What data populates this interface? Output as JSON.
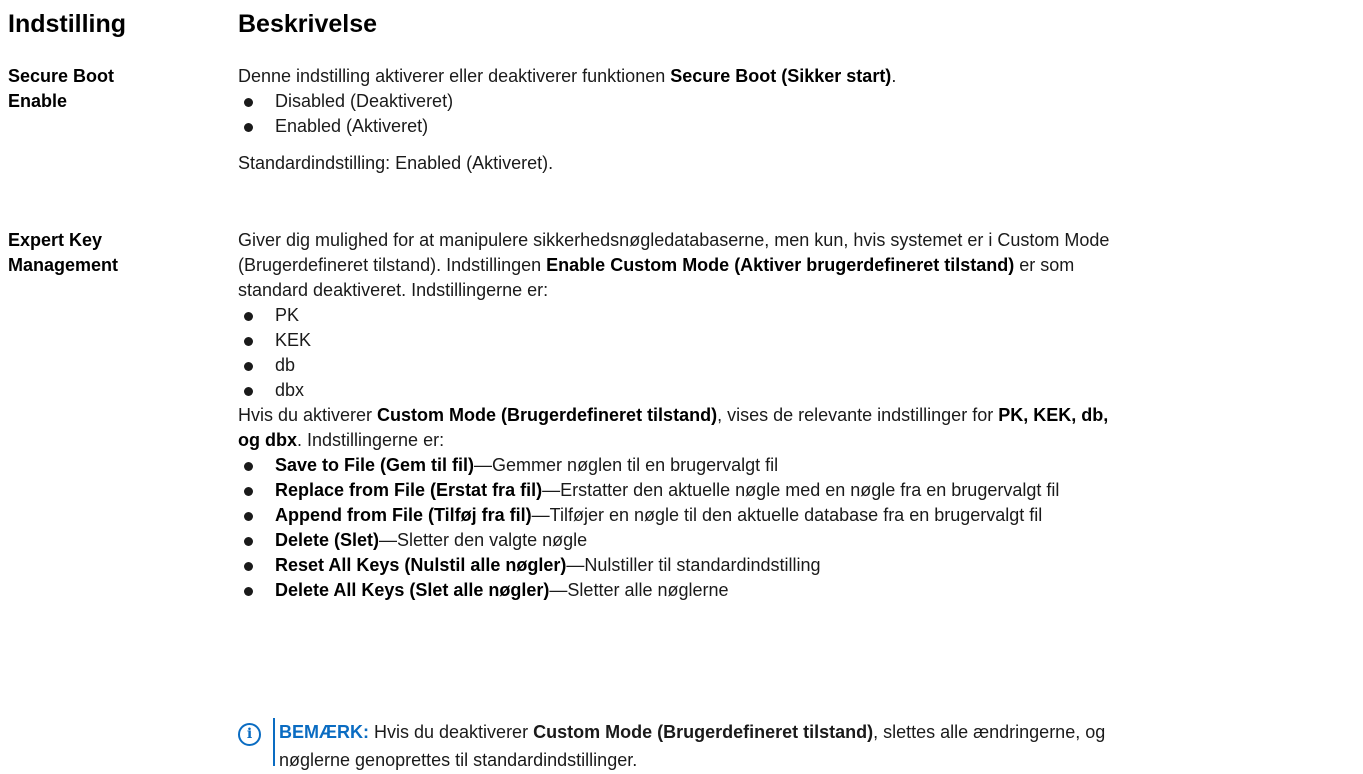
{
  "header": {
    "col1": "Indstilling",
    "col2": "Beskrivelse"
  },
  "rows": [
    {
      "setting": [
        "Secure Boot",
        "Enable"
      ],
      "intro": {
        "pre": "Denne indstilling aktiverer eller deaktiverer funktionen ",
        "bold": "Secure Boot (Sikker start)",
        "post": "."
      },
      "options": [
        "Disabled (Deaktiveret)",
        "Enabled (Aktiveret)"
      ],
      "default": "Standardindstilling: Enabled (Aktiveret)."
    },
    {
      "setting": [
        "Expert Key",
        "Management"
      ],
      "intro": {
        "line1": "Giver dig mulighed for at manipulere sikkerhedsnøgledatabaserne, men kun, hvis systemet er i Custom Mode",
        "line2_pre": "(Brugerdefineret tilstand). Indstillingen ",
        "line2_bold": "Enable Custom Mode (Aktiver brugerdefineret tilstand)",
        "line2_post": " er som",
        "line3": "standard deaktiveret. Indstillingerne er:"
      },
      "keys": [
        "PK",
        "KEK",
        "db",
        "dbx"
      ],
      "custom": {
        "pre": "Hvis du aktiverer ",
        "bold1": "Custom Mode (Brugerdefineret tilstand)",
        "mid": ", vises de relevante indstillinger for ",
        "bold2a": "PK, KEK, db,",
        "bold2b": "og dbx",
        "post": ". Indstillingerne er:"
      },
      "actions": [
        {
          "name": "Save to File (Gem til fil)",
          "desc": "—Gemmer nøglen til en brugervalgt fil"
        },
        {
          "name": "Replace from File (Erstat fra fil)",
          "desc": "—Erstatter den aktuelle nøgle med en nøgle fra en brugervalgt fil"
        },
        {
          "name": "Append from File (Tilføj fra fil)",
          "desc": "—Tilføjer en nøgle til den aktuelle database fra en brugervalgt fil"
        },
        {
          "name": "Delete (Slet)",
          "desc": "—Sletter den valgte nøgle"
        },
        {
          "name": "Reset All Keys (Nulstil alle nøgler)",
          "desc": "—Nulstiller til standardindstilling"
        },
        {
          "name": "Delete All Keys (Slet alle nøgler)",
          "desc": "—Sletter alle nøglerne"
        }
      ],
      "note": {
        "label": "BEMÆRK:",
        "pre": " Hvis du deaktiverer ",
        "bold": "Custom Mode (Brugerdefineret tilstand)",
        "post1": ", slettes alle ændringerne, og",
        "line2": "nøglerne genoprettes til standardindstillinger."
      }
    }
  ],
  "colors": {
    "note_blue": "#0a6cc2",
    "text": "#1a1a1a"
  },
  "icons": {
    "note": "info-icon"
  }
}
